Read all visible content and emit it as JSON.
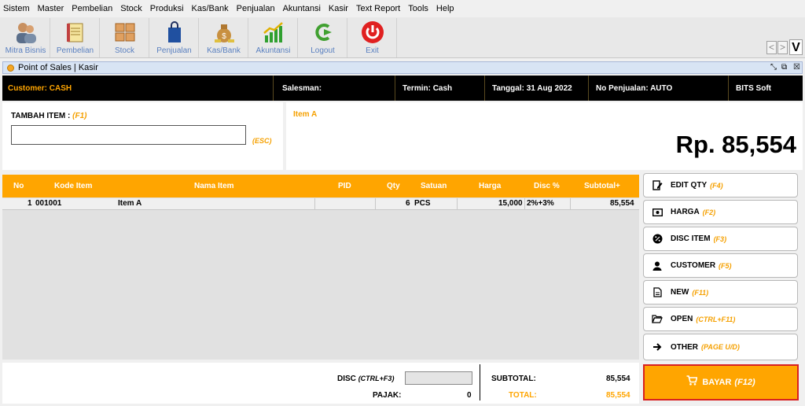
{
  "menu": [
    "Sistem",
    "Master",
    "Pembelian",
    "Stock",
    "Produksi",
    "Kas/Bank",
    "Penjualan",
    "Akuntansi",
    "Kasir",
    "Text Report",
    "Tools",
    "Help"
  ],
  "toolbar": [
    {
      "label": "Mitra Bisnis",
      "icon": "users-icon"
    },
    {
      "label": "Pembelian",
      "icon": "notebook-icon"
    },
    {
      "label": "Stock",
      "icon": "boxes-icon"
    },
    {
      "label": "Penjualan",
      "icon": "shopping-bag-icon"
    },
    {
      "label": "Kas/Bank",
      "icon": "money-bag-icon"
    },
    {
      "label": "Akuntansi",
      "icon": "growth-chart-icon"
    },
    {
      "label": "Logout",
      "icon": "logout-arrow-icon"
    },
    {
      "label": "Exit",
      "icon": "power-icon"
    }
  ],
  "nav": {
    "prev": "<",
    "next": ">",
    "v": "V"
  },
  "window": {
    "title": "Point of Sales | Kasir"
  },
  "info": {
    "customer": "Customer: CASH",
    "salesman": "Salesman:",
    "termin": "Termin: Cash",
    "tanggal": "Tanggal: 31 Aug 2022",
    "no_penjualan": "No Penjualan: AUTO",
    "company": "BITS Soft"
  },
  "entry": {
    "title": "TAMBAH ITEM :",
    "title_key": "(F1)",
    "esc": "(ESC)",
    "value": ""
  },
  "display": {
    "item_name": "Item A",
    "total": "Rp. 85,554"
  },
  "grid": {
    "headers": [
      "No",
      "Kode Item",
      "Nama Item",
      "PID",
      "Qty",
      "Satuan",
      "Harga",
      "Disc %",
      "Subtotal+"
    ],
    "rows": [
      {
        "no": "1",
        "kode": "001001",
        "nama": "Item A",
        "pid": "",
        "qty": "6",
        "satuan": "PCS",
        "harga": "15,000",
        "disc": "2%+3%",
        "subtotal": "85,554"
      }
    ]
  },
  "actions": [
    {
      "label": "EDIT QTY",
      "key": "(F4)",
      "icon": "edit-icon"
    },
    {
      "label": "HARGA",
      "key": "(F2)",
      "icon": "cash-icon"
    },
    {
      "label": "DISC ITEM",
      "key": "(F3)",
      "icon": "discount-badge-icon"
    },
    {
      "label": "CUSTOMER",
      "key": "(F5)",
      "icon": "person-icon"
    },
    {
      "label": "NEW",
      "key": "(F11)",
      "icon": "new-document-icon"
    },
    {
      "label": "OPEN",
      "key": "(CTRL+F11)",
      "icon": "folder-open-icon"
    },
    {
      "label": "OTHER",
      "key": "(PAGE U/D)",
      "icon": "arrow-right-icon"
    }
  ],
  "totals": {
    "disc_label": "DISC",
    "disc_key": "(CTRL+F3)",
    "disc_value": "",
    "pajak_label": "PAJAK:",
    "pajak_value": "0",
    "subtotal_label": "SUBTOTAL:",
    "subtotal_value": "85,554",
    "total_label": "TOTAL:",
    "total_value": "85,554"
  },
  "pay": {
    "label": "BAYAR",
    "key": "(F12)",
    "icon": "cart-icon"
  },
  "colors": {
    "accent": "#ffa500",
    "info_bg": "#000000",
    "pay_border": "#d82020"
  }
}
